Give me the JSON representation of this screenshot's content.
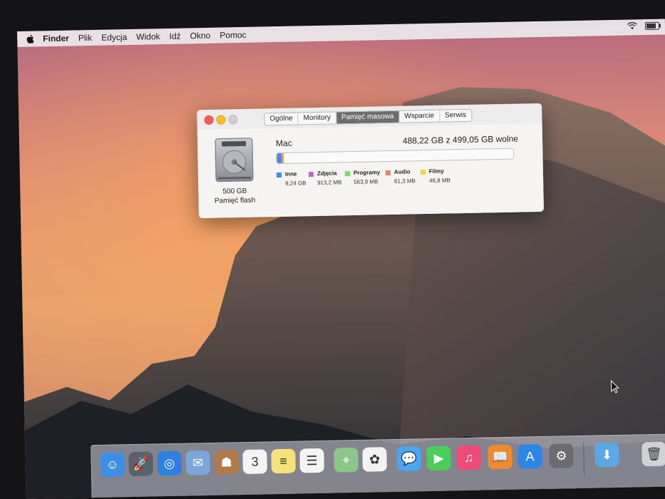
{
  "menubar": {
    "app_name": "Finder",
    "items": [
      "Plik",
      "Edycja",
      "Widok",
      "Idź",
      "Okno",
      "Pomoc"
    ],
    "battery_level": 0.8,
    "icons": [
      "apple-icon",
      "wifi-icon",
      "battery-icon"
    ]
  },
  "window": {
    "tabs": [
      "Ogólne",
      "Monitory",
      "Pamięć masowa",
      "Wsparcie",
      "Serwis"
    ],
    "active_tab": "Pamięć masowa",
    "disk": {
      "size": "500 GB",
      "type": "Pamięć flash"
    },
    "volume": {
      "name": "Mac",
      "free_text": "488,22 GB z 499,05 GB wolne"
    },
    "usage": [
      {
        "name": "Inne",
        "size": "9,24 GB",
        "color": "#4a86e8"
      },
      {
        "name": "Zdjęcia",
        "size": "913,2 MB",
        "color": "#d05ad6"
      },
      {
        "name": "Programy",
        "size": "563,9 MB",
        "color": "#7ed56f"
      },
      {
        "name": "Audio",
        "size": "61,3 MB",
        "color": "#e9855a"
      },
      {
        "name": "Filmy",
        "size": "46,8 MB",
        "color": "#f3d04a"
      }
    ]
  },
  "dock": {
    "apps": [
      {
        "name": "finder-icon",
        "color": "#3d8fe3",
        "glyph": "☺"
      },
      {
        "name": "launchpad-icon",
        "color": "#5b6168",
        "glyph": "🚀"
      },
      {
        "name": "safari-icon",
        "color": "#2f7fe0",
        "glyph": "◎"
      },
      {
        "name": "mail-icon",
        "color": "#7aa7d8",
        "glyph": "✉"
      },
      {
        "name": "contacts-icon",
        "color": "#b07a4a",
        "glyph": "☗"
      },
      {
        "name": "calendar-icon",
        "color": "#f4f4f4",
        "glyph": "3"
      },
      {
        "name": "notes-icon",
        "color": "#f7e27a",
        "glyph": "≡"
      },
      {
        "name": "reminders-icon",
        "color": "#f4f4f4",
        "glyph": "☰"
      },
      {
        "name": "maps-icon",
        "color": "#8cc78a",
        "glyph": "⌖"
      },
      {
        "name": "photos-icon",
        "color": "#f2f2f2",
        "glyph": "✿"
      },
      {
        "name": "messages-icon",
        "color": "#4aa6f0",
        "glyph": "💬"
      },
      {
        "name": "facetime-icon",
        "color": "#4ccd5a",
        "glyph": "▶"
      },
      {
        "name": "itunes-icon",
        "color": "#ee4b78",
        "glyph": "♫"
      },
      {
        "name": "ibooks-icon",
        "color": "#f08a2a",
        "glyph": "📖"
      },
      {
        "name": "app-store-icon",
        "color": "#2d86e6",
        "glyph": "A"
      },
      {
        "name": "system-preferences-icon",
        "color": "#6c6c70",
        "glyph": "⚙"
      },
      {
        "name": "downloads-folder-icon",
        "color": "#5aa8e6",
        "glyph": "⬇"
      },
      {
        "name": "trash-icon",
        "color": "#cfd3d8",
        "glyph": "🗑"
      }
    ]
  }
}
